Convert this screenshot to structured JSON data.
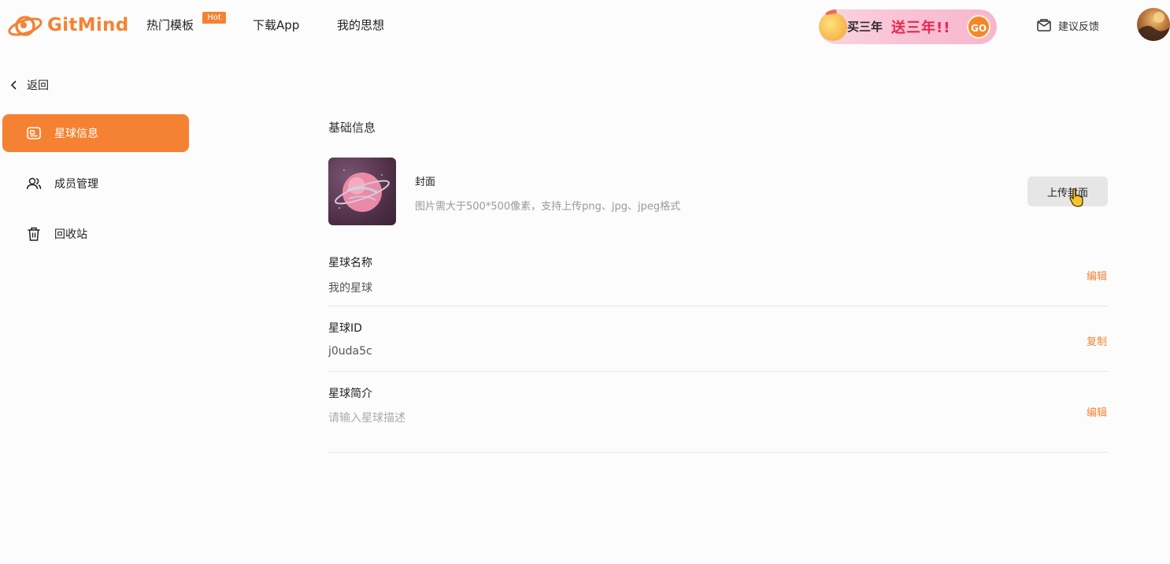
{
  "header": {
    "brand": "GitMind",
    "nav": [
      {
        "label": "热门模板",
        "badge": "Hot"
      },
      {
        "label": "下载App"
      },
      {
        "label": "我的思想"
      }
    ],
    "promo": {
      "part1": "买三年",
      "part2": "送三年!!",
      "go": "GO"
    },
    "feedback": "建议反馈"
  },
  "sidebar": {
    "back": "返回",
    "items": [
      {
        "label": "星球信息",
        "icon": "id-card-icon",
        "active": true
      },
      {
        "label": "成员管理",
        "icon": "users-icon",
        "active": false
      },
      {
        "label": "回收站",
        "icon": "trash-icon",
        "active": false
      }
    ]
  },
  "main": {
    "section_title": "基础信息",
    "cover": {
      "title": "封面",
      "hint": "图片需大于500*500像素，支持上传png、jpg、jpeg格式",
      "upload_label": "上传封面"
    },
    "fields": [
      {
        "label": "星球名称",
        "value": "我的星球",
        "action": "编辑"
      },
      {
        "label": "星球ID",
        "value": "j0uda5c",
        "action": "复制"
      },
      {
        "label": "星球简介",
        "placeholder": "请输入星球描述",
        "action": "编辑"
      }
    ]
  },
  "colors": {
    "accent": "#f58232",
    "brand": "#f58232"
  }
}
